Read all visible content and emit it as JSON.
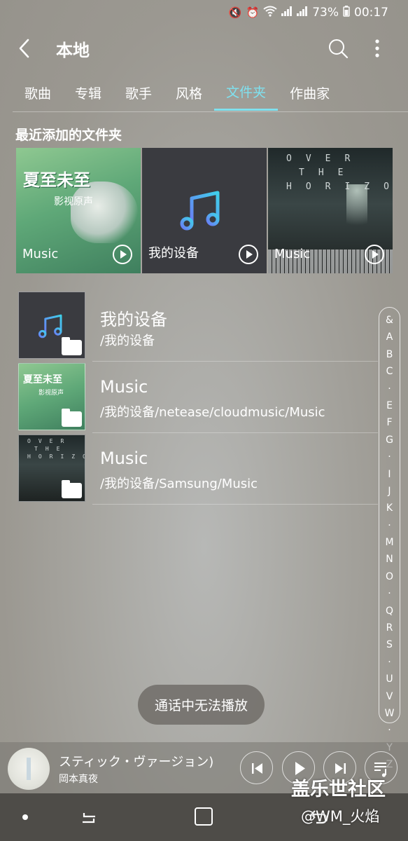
{
  "status_bar": {
    "battery": "73%",
    "time": "00:17",
    "icons": [
      "mute-icon",
      "alarm-icon",
      "wifi-icon",
      "signal-icon",
      "signal-icon",
      "battery-icon"
    ]
  },
  "header": {
    "title": "本地"
  },
  "tabs": [
    {
      "label": "歌曲"
    },
    {
      "label": "专辑"
    },
    {
      "label": "歌手"
    },
    {
      "label": "风格"
    },
    {
      "label": "文件夹",
      "active": true
    },
    {
      "label": "作曲家"
    }
  ],
  "recent": {
    "title": "最近添加的文件夹",
    "cards": [
      {
        "label": "Music",
        "art_title": "夏至未至",
        "art_sub": "影视原声"
      },
      {
        "label": "我的设备"
      },
      {
        "label": "Music",
        "art_lines": [
          "OVER",
          "THE",
          "HORIZON"
        ]
      }
    ]
  },
  "folders": [
    {
      "name": "我的设备",
      "path": "/我的设备"
    },
    {
      "name": "Music",
      "path": "/我的设备/netease/cloudmusic/Music"
    },
    {
      "name": "Music",
      "path": "/我的设备/Samsung/Music"
    }
  ],
  "index_letters": [
    "&",
    "A",
    "B",
    "C",
    "·",
    "E",
    "F",
    "G",
    "·",
    "I",
    "J",
    "K",
    "·",
    "M",
    "N",
    "O",
    "·",
    "Q",
    "R",
    "S",
    "·",
    "U",
    "V",
    "W",
    "·",
    "Y",
    "Z"
  ],
  "toast": {
    "text": "通话中无法播放"
  },
  "mini_player": {
    "title": "スティック・ヴァージョン)",
    "artist": "岡本真夜"
  },
  "watermark": {
    "main": "盖乐世社区",
    "sub": "@WM_火焰"
  },
  "colors": {
    "accent": "#7fe1ef"
  }
}
